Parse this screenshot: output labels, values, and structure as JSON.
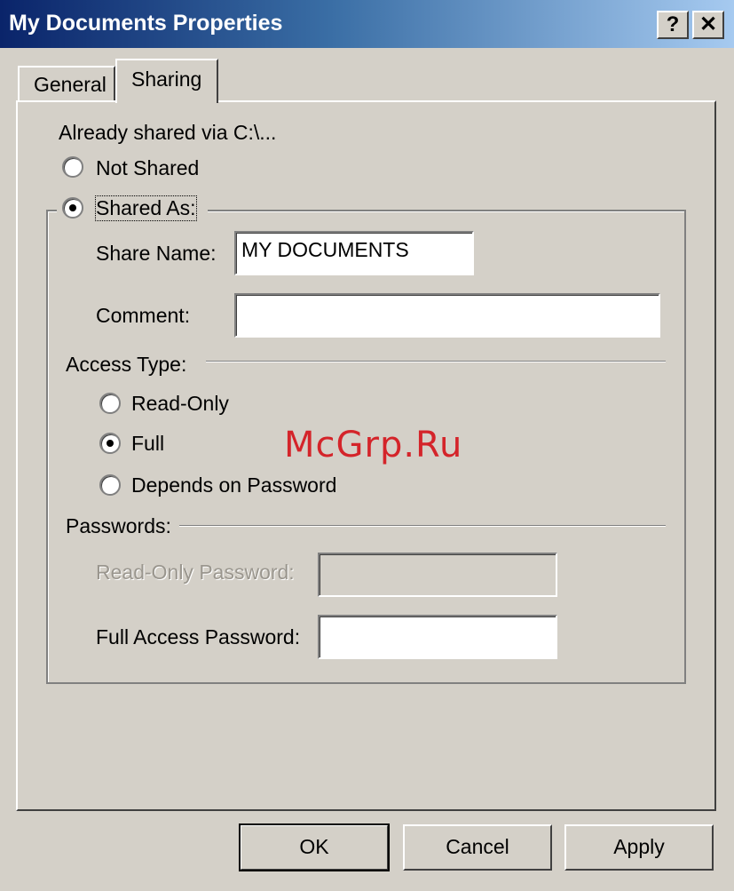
{
  "window": {
    "title": "My Documents Properties",
    "help_glyph": "?",
    "close_glyph": "✕"
  },
  "tabs": [
    {
      "label": "General",
      "active": false
    },
    {
      "label": "Sharing",
      "active": true
    }
  ],
  "sharing": {
    "already_shared": "Already shared via C:\\...",
    "not_shared_label": "Not Shared",
    "shared_as_label": "Shared As:",
    "selected": "Shared As:",
    "share_name_label": "Share Name:",
    "share_name_value": "MY DOCUMENTS",
    "comment_label": "Comment:",
    "comment_value": "",
    "access_type_label": "Access Type:",
    "access_options": [
      "Read-Only",
      "Full",
      "Depends on Password"
    ],
    "access_selected": "Full",
    "passwords_label": "Passwords:",
    "read_only_password_label": "Read-Only Password:",
    "read_only_password_value": "",
    "full_access_password_label": "Full Access Password:",
    "full_access_password_value": ""
  },
  "buttons": {
    "ok": "OK",
    "cancel": "Cancel",
    "apply": "Apply"
  },
  "watermark": "McGrp.Ru",
  "colors": {
    "face": "#d4d0c8",
    "title_start": "#0a246a",
    "title_end": "#a6caf0",
    "watermark": "#d4242a"
  }
}
